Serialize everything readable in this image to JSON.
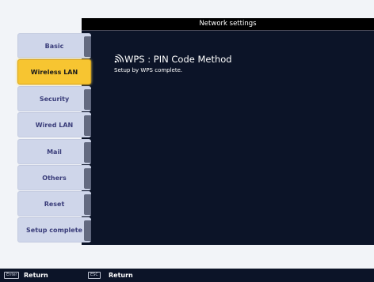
{
  "panel": {
    "title": "Network settings"
  },
  "sidebar": {
    "items": [
      {
        "label": "Basic"
      },
      {
        "label": "Wireless LAN"
      },
      {
        "label": "Security"
      },
      {
        "label": "Wired LAN"
      },
      {
        "label": "Mail"
      },
      {
        "label": "Others"
      },
      {
        "label": "Reset"
      },
      {
        "label": "Setup complete"
      }
    ],
    "active_index": 1
  },
  "content": {
    "heading": "WPS : PIN Code Method",
    "heading_icon": "wireless-signal-icon",
    "message": "Setup by WPS complete."
  },
  "footer": {
    "keys": [
      {
        "key": "Enter",
        "label": "Return"
      },
      {
        "key": "ESC",
        "label": "Return"
      }
    ]
  },
  "colors": {
    "panel_bg": "#0c1428",
    "active_item": "#f7c531",
    "inactive_item": "#cfd6ea"
  }
}
